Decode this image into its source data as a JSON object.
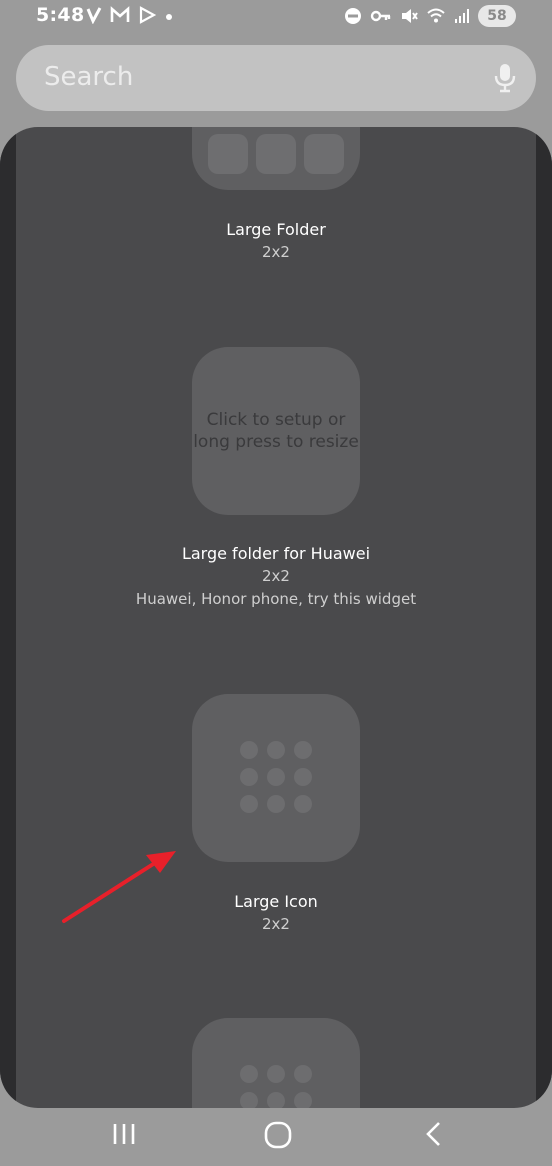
{
  "status_bar": {
    "time": "5:48",
    "battery": "58",
    "left_icons": [
      "check-icon",
      "gmail-icon",
      "play-store-icon",
      "dot-icon"
    ],
    "right_icons": [
      "do-not-disturb-icon",
      "key-icon",
      "mute-icon",
      "wifi-icon",
      "signal-icon",
      "battery-icon"
    ]
  },
  "search": {
    "placeholder": "Search",
    "mic_icon": "mic-icon"
  },
  "widgets": [
    {
      "title": "Large Folder",
      "size": "2x2"
    },
    {
      "title": "Large folder for Huawei",
      "size": "2x2",
      "note": "Huawei, Honor phone, try this widget",
      "preview_text_line1": "Click to setup or",
      "preview_text_line2": "long press to resize"
    },
    {
      "title": "Large Icon",
      "size": "2x2"
    },
    {
      "title": "",
      "size": ""
    }
  ],
  "annotation": {
    "arrow_color": "#e8202a"
  },
  "nav": {
    "recents_icon": "recents-icon",
    "home_icon": "home-icon",
    "back_icon": "back-icon"
  }
}
